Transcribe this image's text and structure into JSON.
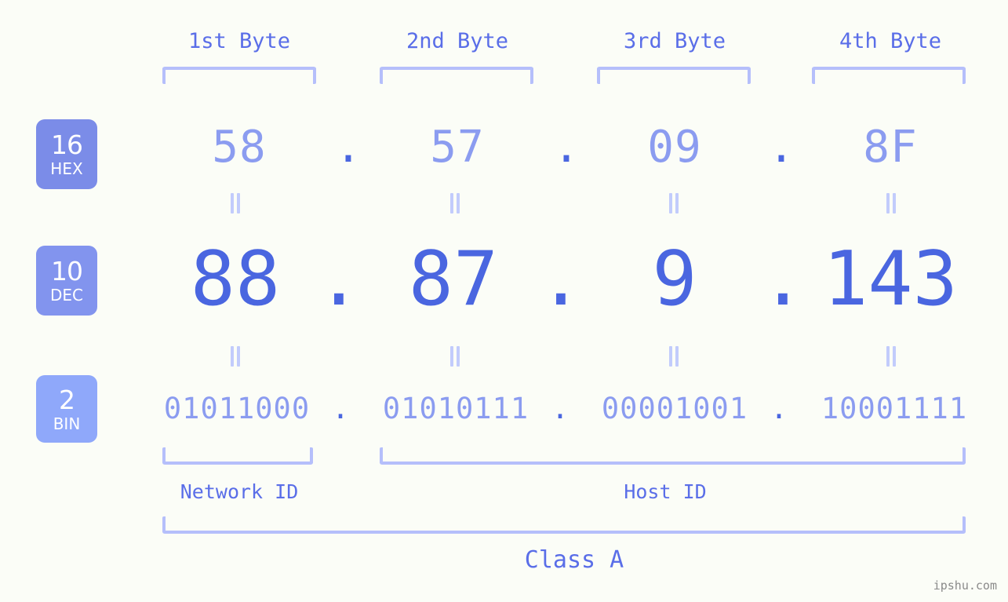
{
  "meta": {
    "watermark": "ipshu.com",
    "background_color": "#fbfdf7",
    "accent_color": "#4a66e0",
    "muted_accent_color": "#8b9cf0",
    "bracket_color": "#b5bffb"
  },
  "byte_headers": [
    {
      "label": "1st Byte"
    },
    {
      "label": "2nd Byte"
    },
    {
      "label": "3rd Byte"
    },
    {
      "label": "4th Byte"
    }
  ],
  "radix_rows": [
    {
      "badge_number": "16",
      "badge_abbr": "HEX",
      "badge_color": "#7b8ce8",
      "values": [
        "58",
        "57",
        "09",
        "8F"
      ],
      "separator": "."
    },
    {
      "badge_number": "10",
      "badge_abbr": "DEC",
      "badge_color": "#8294ee",
      "values": [
        "88",
        "87",
        "9",
        "143"
      ],
      "separator": "."
    },
    {
      "badge_number": "2",
      "badge_abbr": "BIN",
      "badge_color": "#8fa8fa",
      "values": [
        "01011000",
        "01010111",
        "00001001",
        "10001111"
      ],
      "separator": "."
    }
  ],
  "sections": {
    "network_id_label": "Network ID",
    "host_id_label": "Host ID",
    "class_label": "Class A"
  }
}
